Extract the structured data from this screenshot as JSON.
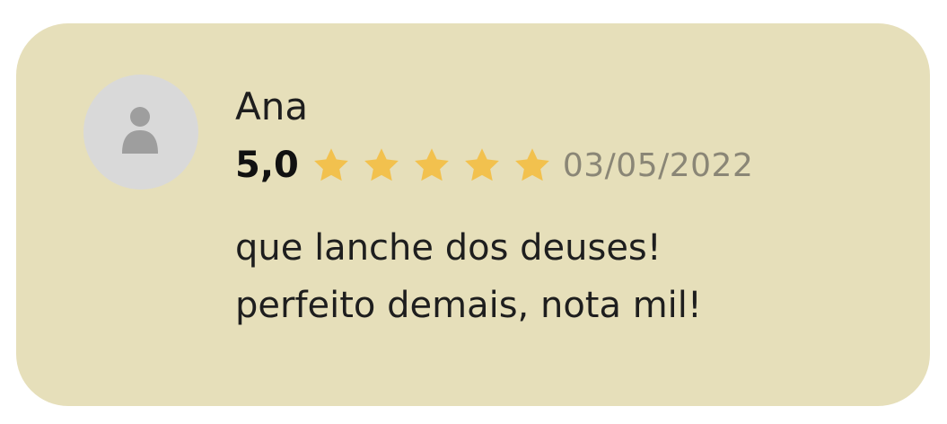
{
  "review": {
    "author": "Ana",
    "avatar_icon": "user-placeholder-icon",
    "score": "5,0",
    "stars": 5,
    "star_color": "#f2c14e",
    "date": "03/05/2022",
    "comment_lines": [
      "que lanche dos deuses!",
      "perfeito demais, nota mil!"
    ],
    "card_color": "#e6dfba"
  }
}
